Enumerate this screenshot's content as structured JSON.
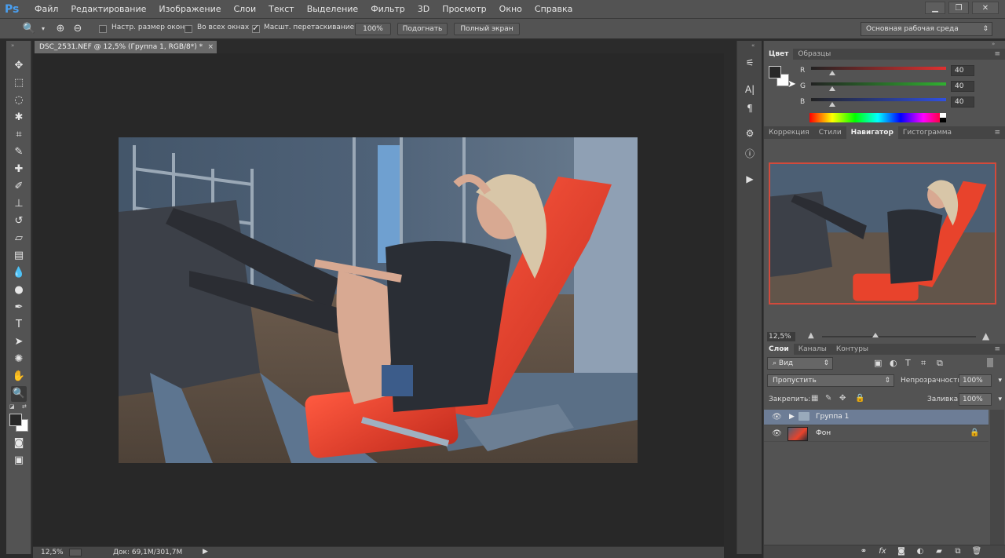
{
  "app": {
    "logo": "Ps"
  },
  "menu": [
    "Файл",
    "Редактирование",
    "Изображение",
    "Слои",
    "Текст",
    "Выделение",
    "Фильтр",
    "3D",
    "Просмотр",
    "Окно",
    "Справка"
  ],
  "window_controls": {
    "minimize": "▁",
    "restore": "❐",
    "close": "✕"
  },
  "options": {
    "resize_windows": {
      "label": "Настр. размер окон",
      "checked": false
    },
    "all_windows": {
      "label": "Во всех окнах",
      "checked": false
    },
    "scrubby_zoom": {
      "label": "Масшт. перетаскиванием",
      "checked": true
    },
    "btn_100": "100%",
    "btn_fit": "Подогнать",
    "btn_fullscreen": "Полный экран",
    "workspace": "Основная рабочая среда"
  },
  "document": {
    "tab_title": "DSC_2531.NEF @ 12,5% (Группа 1, RGB/8*) *",
    "zoom": "12,5%",
    "doc_size": "Док: 69,1M/301,7M"
  },
  "color_panel": {
    "tabs": [
      "Цвет",
      "Образцы"
    ],
    "channels": [
      {
        "name": "R",
        "value": "40",
        "color": "#e03030",
        "fraction": 0.157
      },
      {
        "name": "G",
        "value": "40",
        "color": "#30b030",
        "fraction": 0.157
      },
      {
        "name": "B",
        "value": "40",
        "color": "#3050e0",
        "fraction": 0.157
      }
    ],
    "foreground": "#282828",
    "background": "#ffffff"
  },
  "navigator_panel": {
    "tabs": [
      "Коррекция",
      "Стили",
      "Навигатор",
      "Гистограмма"
    ],
    "zoom": "12,5%"
  },
  "layers_panel": {
    "tabs": [
      "Слои",
      "Каналы",
      "Контуры"
    ],
    "filter": "Вид",
    "blend_mode": "Пропустить",
    "opacity_label": "Непрозрачность:",
    "opacity": "100%",
    "lock_label": "Закрепить:",
    "fill_label": "Заливка:",
    "fill": "100%",
    "layers": [
      {
        "name": "Группа 1",
        "type": "group",
        "selected": true
      },
      {
        "name": "Фон",
        "type": "image",
        "selected": false,
        "locked": true
      }
    ]
  }
}
